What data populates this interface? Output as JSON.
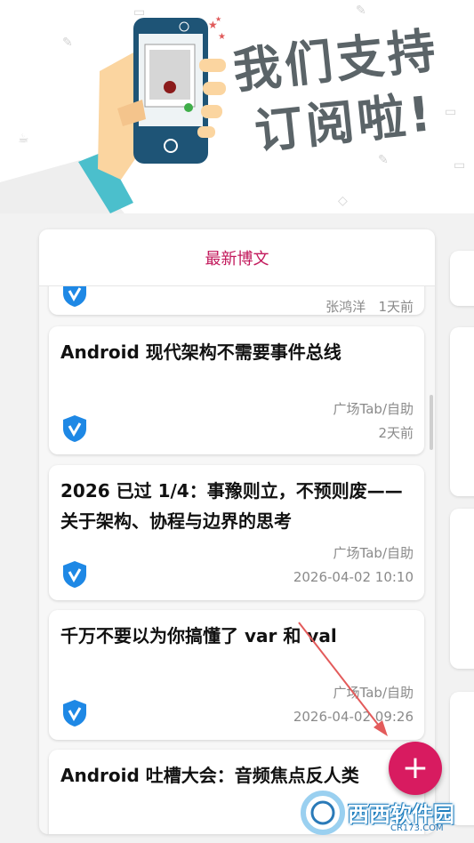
{
  "banner": {
    "line1": "我们支持",
    "line2": "订阅啦!"
  },
  "section": {
    "title": "最新博文"
  },
  "posts": [
    {
      "title": "",
      "meta_top": "张鸿洋",
      "meta_bottom": "1天前",
      "partial": true
    },
    {
      "title": "Android 现代架构不需要事件总线",
      "meta_top": "广场Tab/自助",
      "meta_bottom": "2天前"
    },
    {
      "title": "2026 已过 1/4：事豫则立，不预则废——关于架构、协程与边界的思考",
      "meta_top": "广场Tab/自助",
      "meta_bottom": "2026-04-02 10:10"
    },
    {
      "title": "千万不要以为你搞懂了 var 和 val",
      "meta_top": "广场Tab/自助",
      "meta_bottom": "2026-04-02 09:26"
    },
    {
      "title": "Android 吐槽大会：音频焦点反人类",
      "meta_top": "",
      "meta_bottom": ""
    }
  ],
  "fab": {
    "label": "+"
  },
  "watermark": {
    "text": "西西软件园",
    "url": "CR173.COM"
  },
  "colors": {
    "accent": "#d81b60",
    "title": "#c2185b",
    "shield": "#1e88e5"
  }
}
